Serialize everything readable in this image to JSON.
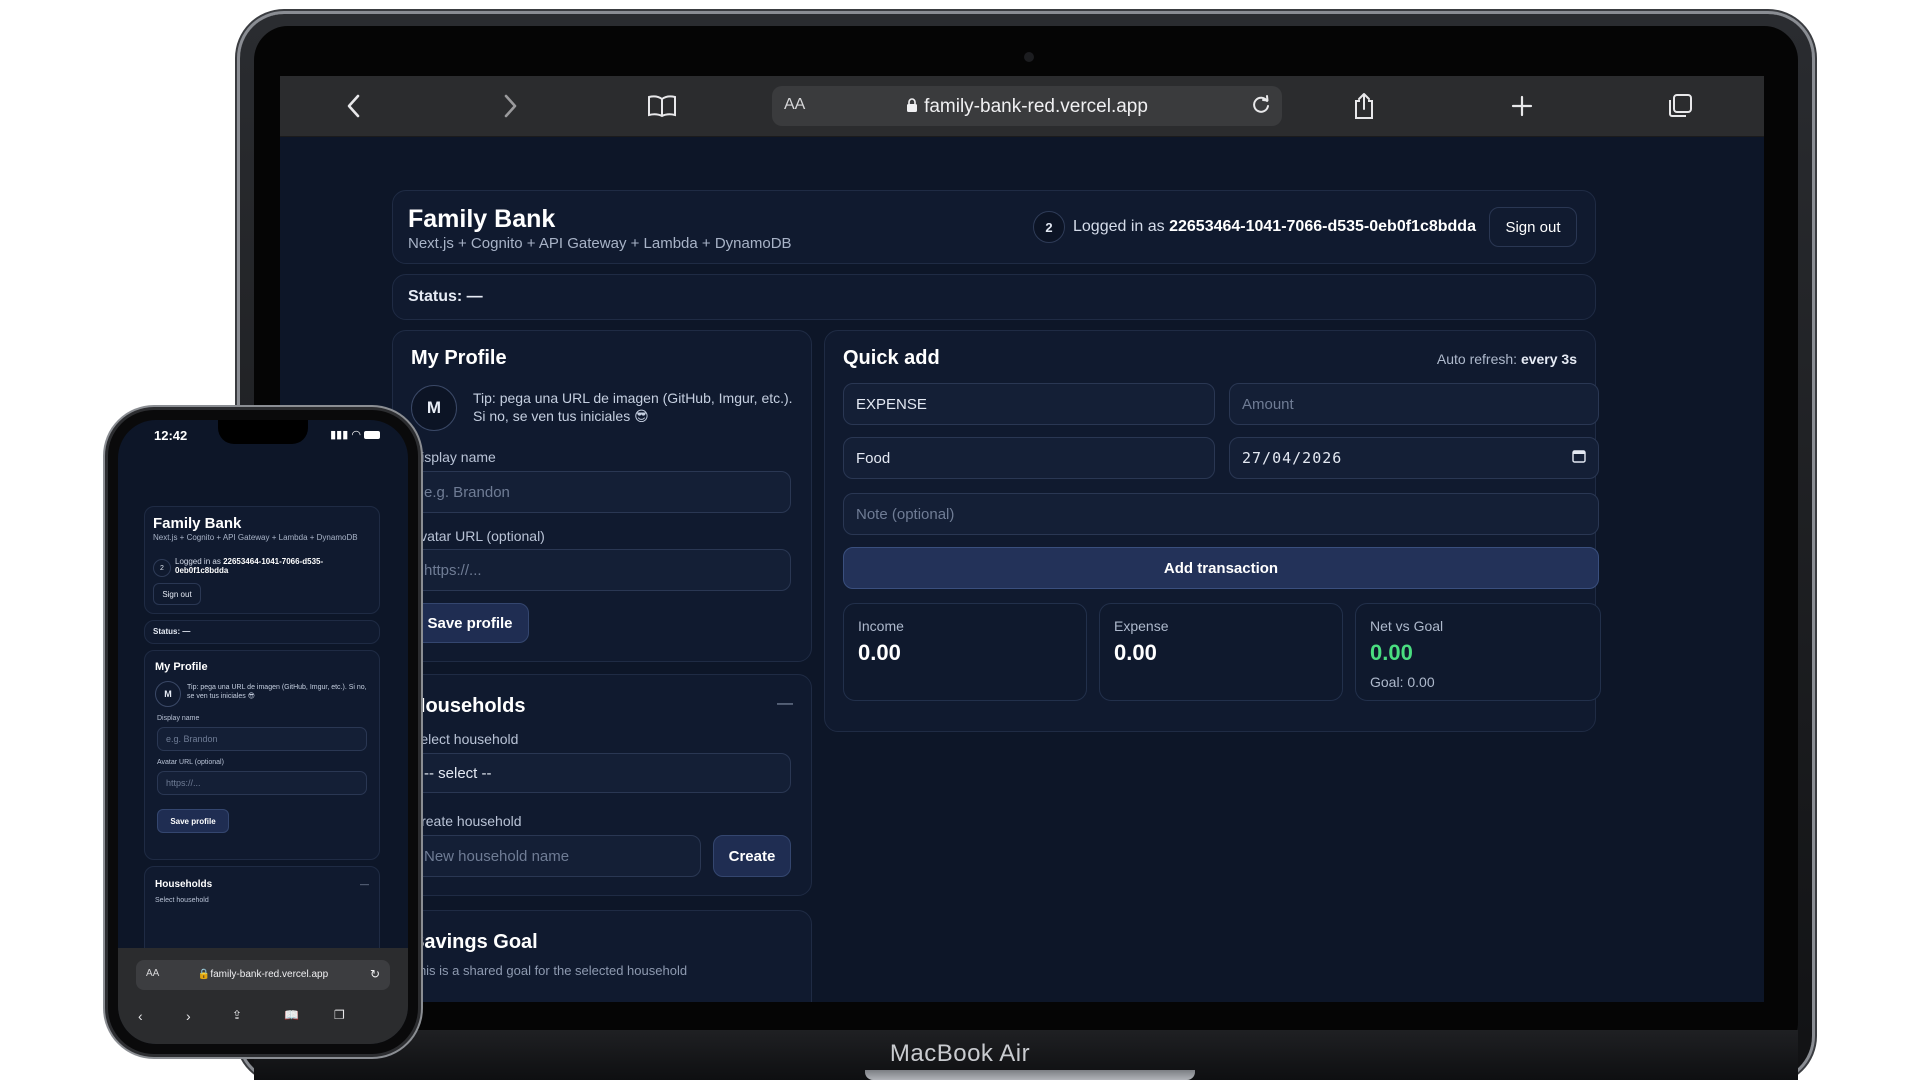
{
  "device": {
    "laptop_label": "MacBook Air"
  },
  "browser": {
    "aa": "AA",
    "url": "family-bank-red.vercel.app"
  },
  "header": {
    "title": "Family Bank",
    "subtitle": "Next.js + Cognito + API Gateway + Lambda + DynamoDB",
    "badge_count": "2",
    "logged_in_prefix": "Logged in as",
    "user_id": "22653464-1041-7066-d535-0eb0f1c8bdda",
    "sign_out": "Sign out"
  },
  "status": {
    "text": "Status: —"
  },
  "profile": {
    "title": "My Profile",
    "avatar_initial": "M",
    "tip": "Tip: pega una URL de imagen (GitHub, Imgur, etc.). Si no, se ven tus iniciales 😎",
    "display_name_label": "Display name",
    "display_name_placeholder": "e.g. Brandon",
    "avatar_url_label": "Avatar URL (optional)",
    "avatar_url_placeholder": "https://...",
    "save_button": "Save profile"
  },
  "households": {
    "title": "Households",
    "collapse": "—",
    "select_label": "Select household",
    "select_value": "-- select --",
    "create_label": "Create household",
    "create_placeholder": "New household name",
    "create_button": "Create"
  },
  "savings": {
    "title": "Savings Goal",
    "partial_text": "This is a shared goal for the selected household"
  },
  "quick_add": {
    "title": "Quick add",
    "auto_refresh_label": "Auto refresh:",
    "auto_refresh_value": "every 3s",
    "type_value": "EXPENSE",
    "amount_placeholder": "Amount",
    "category_value": "Food",
    "date_value": "27/04/2026",
    "note_placeholder": "Note (optional)",
    "add_button": "Add transaction"
  },
  "stats": {
    "income_label": "Income",
    "income_value": "0.00",
    "expense_label": "Expense",
    "expense_value": "0.00",
    "net_label": "Net vs Goal",
    "net_value": "0.00",
    "goal_text": "Goal: 0.00",
    "net_color": "#4ade80"
  },
  "phone": {
    "time": "12:42",
    "title": "Family Bank",
    "subtitle": "Next.js + Cognito + API Gateway + Lambda + DynamoDB",
    "badge_count": "2",
    "logged_in_prefix": "Logged in as",
    "user_id": "22653464-1041-7066-d535-0eb0f1c8bdda",
    "sign_out": "Sign out",
    "status": "Status: —",
    "profile_title": "My Profile",
    "avatar_initial": "M",
    "tip": "Tip: pega una URL de imagen (GitHub, Imgur, etc.). Si no, se ven tus iniciales 😎",
    "display_name_label": "Display name",
    "display_name_placeholder": "e.g. Brandon",
    "avatar_url_label": "Avatar URL (optional)",
    "avatar_url_placeholder": "https://...",
    "save_button": "Save profile",
    "households_title": "Households",
    "collapse": "—",
    "select_label": "Select household",
    "aa": "AA",
    "url": "family-bank-red.vercel.app"
  }
}
